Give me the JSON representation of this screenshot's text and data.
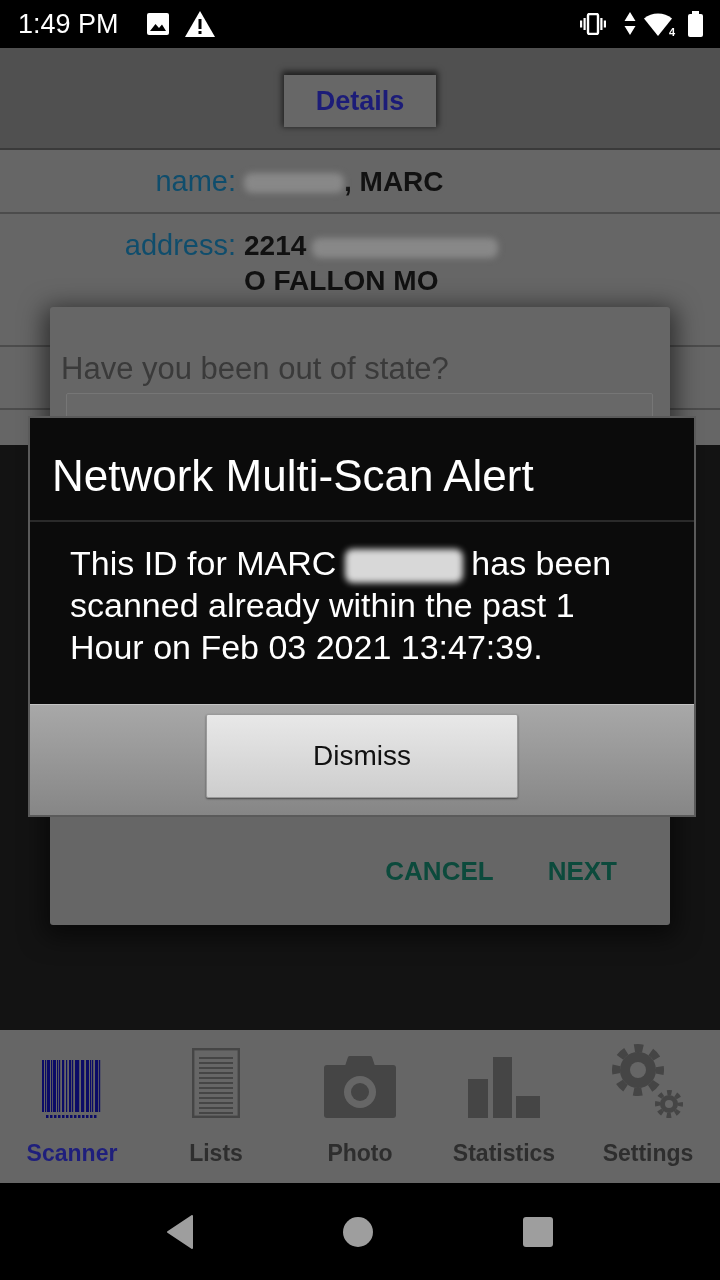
{
  "status_bar": {
    "time": "1:49 PM",
    "network_badge": "4"
  },
  "header": {
    "tabs": [
      {
        "label": "Details",
        "selected": true
      }
    ]
  },
  "details": [
    {
      "label": "name:",
      "lines": [
        [
          {
            "kind": "redacted"
          },
          {
            "kind": "text",
            "text": ", MARC"
          }
        ]
      ]
    },
    {
      "label": "address:",
      "lines": [
        [
          {
            "kind": "text",
            "text": "2214"
          },
          {
            "kind": "redacted"
          }
        ],
        [
          {
            "kind": "text",
            "text": "O FALLON MO"
          }
        ]
      ]
    }
  ],
  "question_dialog": {
    "question": "Have you been out of state?",
    "buttons": [
      "CANCEL",
      "NEXT"
    ]
  },
  "alert": {
    "title": "Network Multi-Scan Alert",
    "message": [
      {
        "kind": "text",
        "text": "This ID for MARC"
      },
      {
        "kind": "redacted"
      },
      {
        "kind": "text",
        "text": "has been scanned already within the past 1 Hour on Feb 03 2021 13:47:39."
      }
    ],
    "button": "Dismiss"
  },
  "bottom_nav": [
    {
      "kind": "scanner",
      "label": "Scanner",
      "selected": true
    },
    {
      "kind": "lists",
      "label": "Lists",
      "selected": false
    },
    {
      "kind": "photo",
      "label": "Photo",
      "selected": false
    },
    {
      "kind": "statistics",
      "label": "Statistics",
      "selected": false
    },
    {
      "kind": "settings",
      "label": "Settings",
      "selected": false
    }
  ]
}
